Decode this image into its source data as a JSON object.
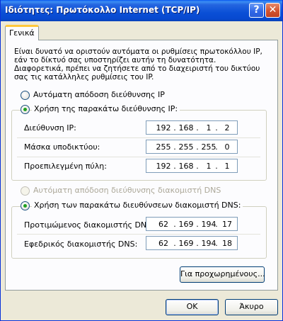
{
  "window": {
    "title": "Ιδιότητες: Πρωτόκολλο Internet (TCP/IP)",
    "help_glyph": "?",
    "close_glyph": "✕"
  },
  "tabs": [
    {
      "label": "Γενικά",
      "active": true
    }
  ],
  "intro_text": "Είναι δυνατό να οριστούν αυτόματα οι ρυθμίσεις πρωτοκόλλου IP, εάν το δίκτυό σας υποστηρίζει αυτήν τη δυνατότητα. Διαφορετικά, πρέπει να ζητήσετε από το διαχειριστή του δικτύου σας τις κατάλληλες ρυθμίσεις του IP.",
  "ip_section": {
    "auto_label": "Αυτόματη απόδοση διεύθυνσης IP",
    "manual_label": "Χρήση της παρακάτω διεύθυνσης IP:",
    "selected": "manual",
    "fields": [
      {
        "label": "Διεύθυνση IP:",
        "octets": [
          "192",
          "168",
          "1",
          "2"
        ]
      },
      {
        "label": "Μάσκα υποδικτύου:",
        "octets": [
          "255",
          "255",
          "255",
          "0"
        ]
      },
      {
        "label": "Προεπιλεγμένη πύλη:",
        "octets": [
          "192",
          "168",
          "1",
          "1"
        ]
      }
    ]
  },
  "dns_section": {
    "auto_label": "Αυτόματη απόδοση διεύθυνσης διακομιστή DNS",
    "manual_label": "Χρήση των παρακάτω διευθύνσεων διακομιστή DNS:",
    "selected": "manual",
    "auto_disabled": true,
    "fields": [
      {
        "label": "Προτιμώμενος διακομιστής DNS:",
        "octets": [
          "62",
          "169",
          "194",
          "17"
        ]
      },
      {
        "label": "Εφεδρικός διακομιστής DNS:",
        "octets": [
          "62",
          "169",
          "194",
          "18"
        ]
      }
    ]
  },
  "buttons": {
    "advanced": "Για προχωρημένους...",
    "ok": "OK",
    "cancel": "Άκυρο"
  },
  "dot_char": "."
}
